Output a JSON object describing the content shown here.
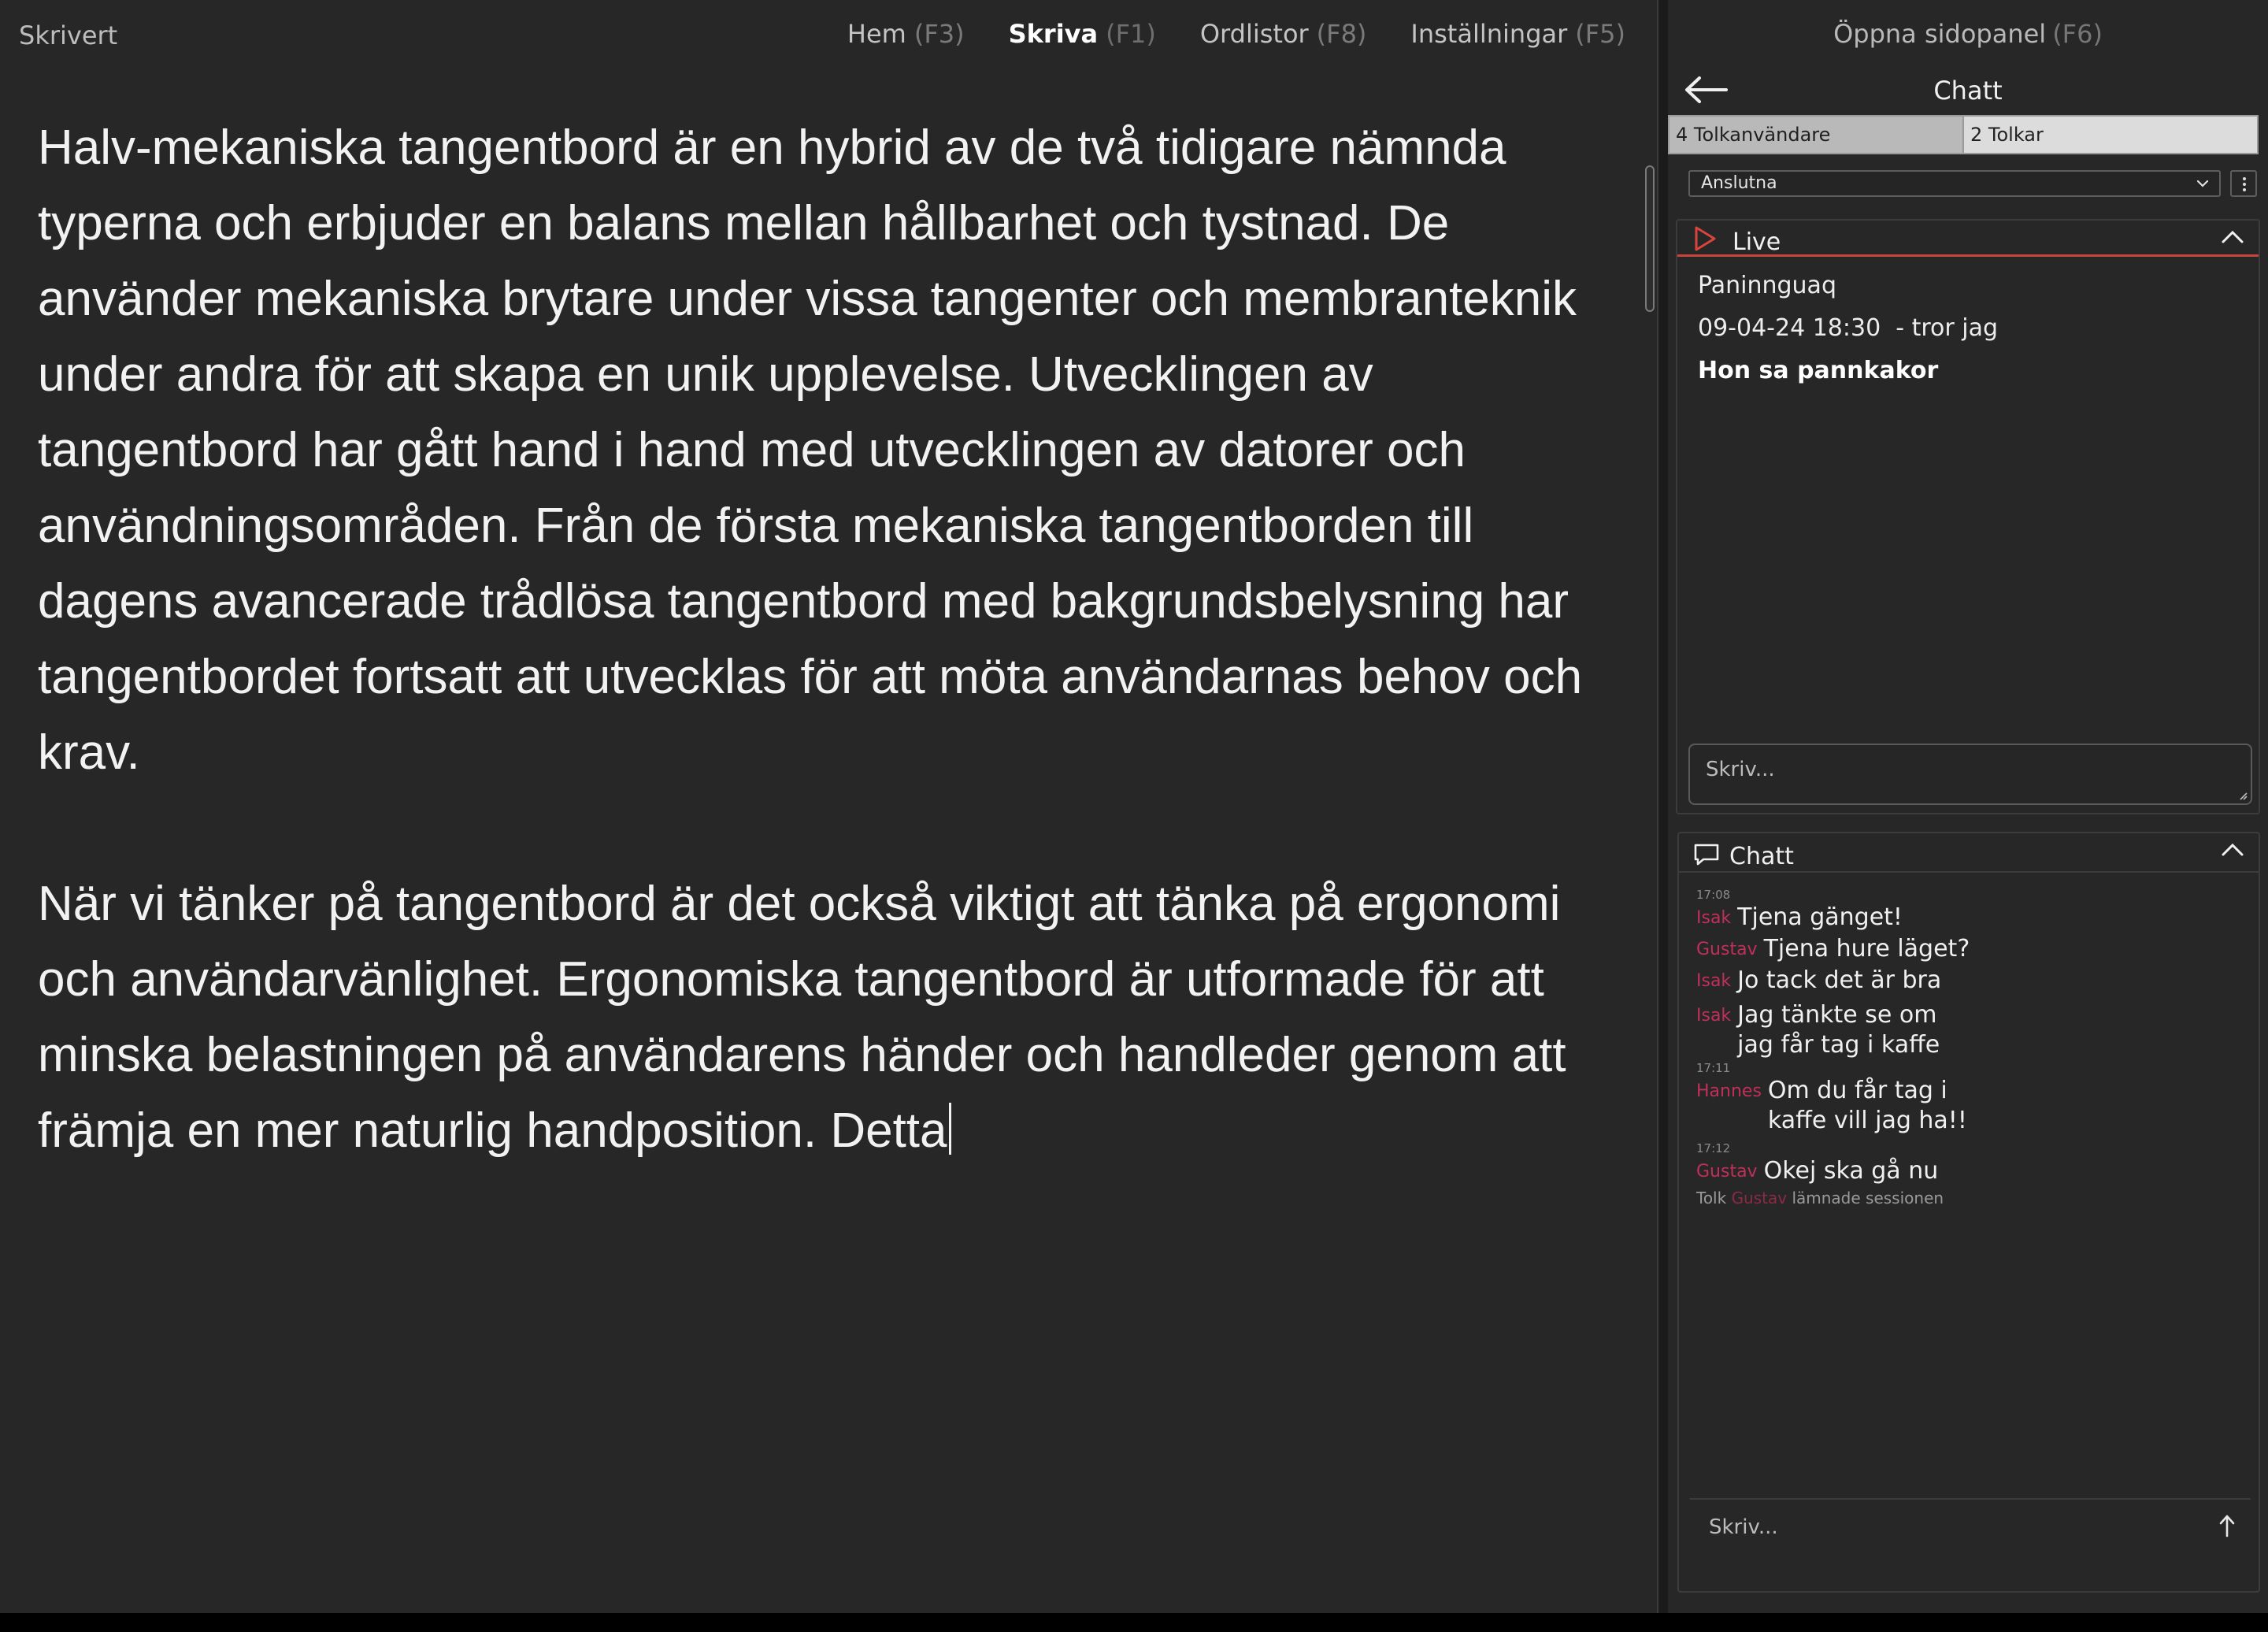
{
  "app": {
    "title": "Skrivert"
  },
  "nav": [
    {
      "label": "Hem",
      "key": "(F3)",
      "active": false
    },
    {
      "label": "Skriva",
      "key": "(F1)",
      "active": true
    },
    {
      "label": "Ordlistor",
      "key": "(F8)",
      "active": false
    },
    {
      "label": "Inställningar",
      "key": "(F5)",
      "active": false
    }
  ],
  "editor": {
    "paragraphs": [
      "Halv-mekaniska tangentbord är en hybrid av de två tidigare nämnda typerna och erbjuder en balans mellan hållbarhet och tystnad. De använder mekaniska brytare under vissa tangenter och membranteknik under andra för att skapa en unik upplevelse. Utvecklingen av tangentbord har gått hand i hand med utvecklingen av datorer och användningsområden. Från de första mekaniska tangentborden till dagens avancerade trådlösa tangentbord med bakgrundsbelysning har tangentbordet fortsatt att utvecklas för att möta användarnas behov och krav.",
      "När vi tänker på tangentbord är det också viktigt att tänka på ergonomi och användarvänlighet. Ergonomiska tangentbord är utformade för att minska belastningen på användarens händer och handleder genom att främja en mer naturlig handposition. Detta"
    ]
  },
  "side": {
    "open_label": "Öppna sidopanel",
    "open_key": "(F6)",
    "header_title": "Chatt",
    "tabs": [
      {
        "label": "4 Tolkanvändare"
      },
      {
        "label": "2 Tolkar"
      }
    ],
    "dropdown_value": "Anslutna",
    "live": {
      "label": "Live",
      "lines": [
        "Paninnguaq",
        "09-04-24 18:30  - tror jag",
        "Hon sa pannkakor"
      ],
      "input_placeholder": "Skriv..."
    },
    "chat": {
      "title": "Chatt",
      "ts1": "17:08",
      "ts2": "17:11",
      "ts3": "17:12",
      "messages": [
        {
          "name": "Isak",
          "text": "Tjena gänget!"
        },
        {
          "name": "Gustav",
          "text": "Tjena hure läget?"
        },
        {
          "name": "Isak",
          "text": "Jo tack det är bra"
        },
        {
          "name": "Isak",
          "text": "Jag tänkte se om jag får tag i kaffe"
        },
        {
          "name": "Hannes",
          "text": "Om du får tag i kaffe vill jag ha!!"
        },
        {
          "name": "Gustav",
          "text": "Okej ska gå nu"
        }
      ],
      "system": {
        "prefix": "Tolk",
        "name": "Gustav",
        "suffix": "lämnade sessionen"
      },
      "input_placeholder": "Skriv..."
    }
  },
  "colors": {
    "accent_red": "#c9453c",
    "name_pink": "#c0305a",
    "background": "#272727"
  }
}
